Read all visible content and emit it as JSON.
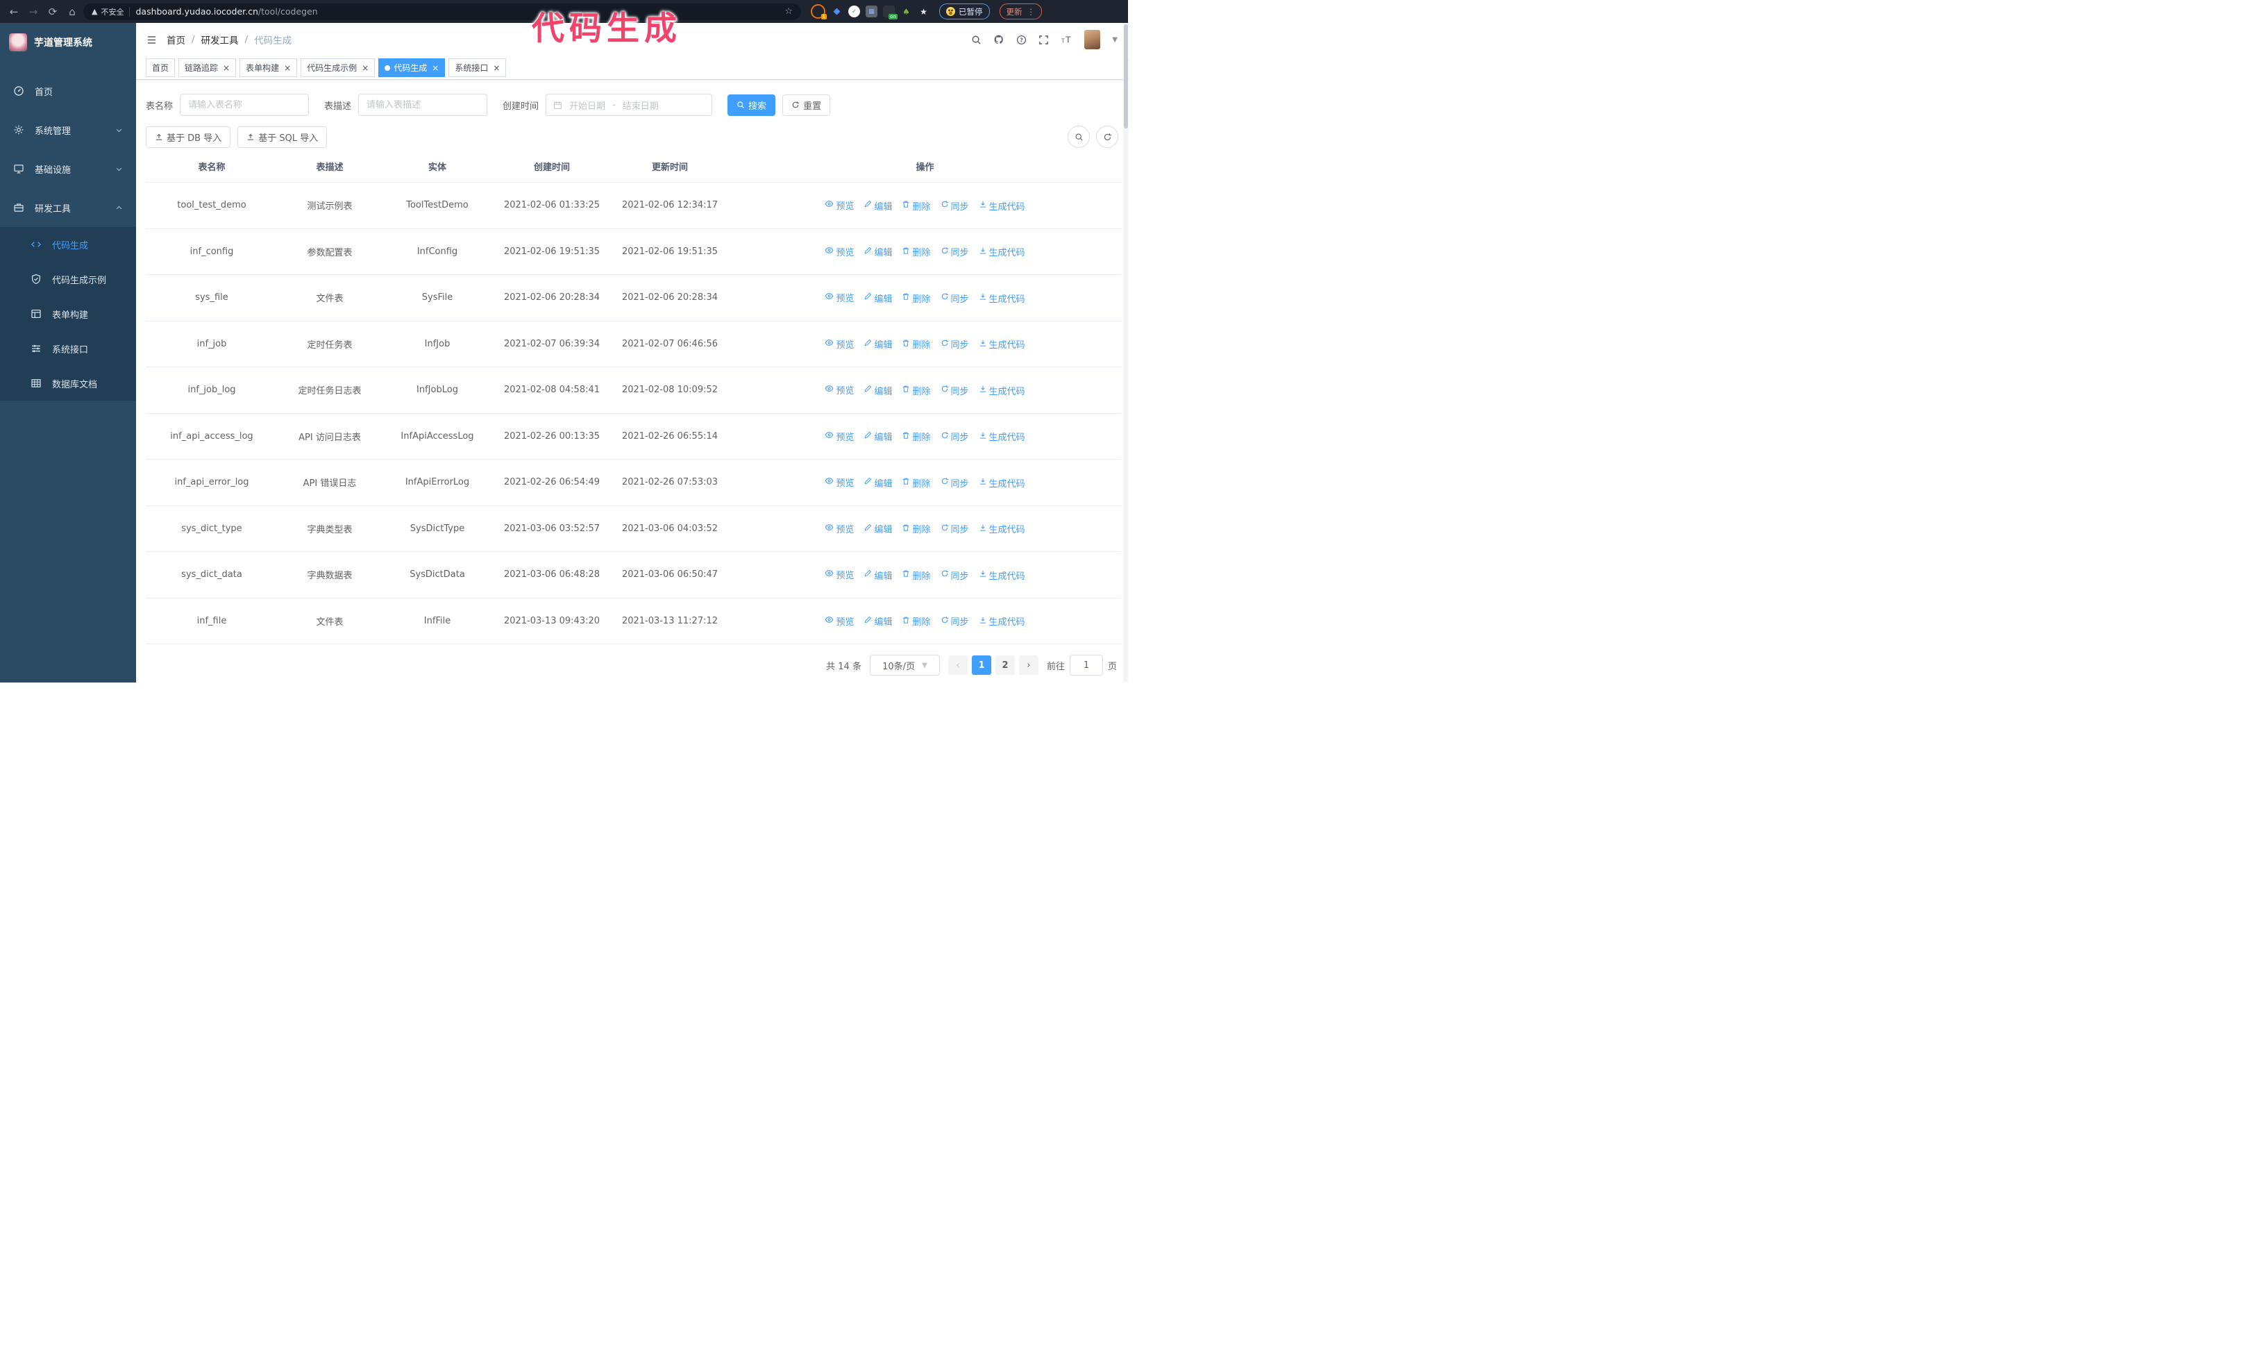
{
  "annotation": {
    "text": "代码生成",
    "color": "#f2436a"
  },
  "browser": {
    "security_label": "不安全",
    "url_host": "dashboard.yudao.iocoder.cn",
    "url_path": "/tool/codegen",
    "paused_label": "已暂停",
    "update_label": "更新"
  },
  "sidebar": {
    "logo_title": "芋道管理系统",
    "menu": [
      {
        "label": "首页",
        "icon": "home-icon"
      },
      {
        "label": "系统管理",
        "icon": "gear-icon",
        "chevron": "down"
      },
      {
        "label": "基础设施",
        "icon": "monitor-icon",
        "chevron": "down"
      },
      {
        "label": "研发工具",
        "icon": "toolbox-icon",
        "chevron": "up",
        "children": [
          {
            "label": "代码生成",
            "icon": "code-icon",
            "active": true
          },
          {
            "label": "代码生成示例",
            "icon": "shield-check-icon"
          },
          {
            "label": "表单构建",
            "icon": "form-icon"
          },
          {
            "label": "系统接口",
            "icon": "sliders-icon"
          },
          {
            "label": "数据库文档",
            "icon": "database-table-icon"
          }
        ]
      }
    ]
  },
  "header": {
    "breadcrumb": [
      "首页",
      "研发工具",
      "代码生成"
    ]
  },
  "tabs": [
    {
      "label": "首页",
      "closable": false,
      "active": false
    },
    {
      "label": "链路追踪",
      "closable": true,
      "active": false
    },
    {
      "label": "表单构建",
      "closable": true,
      "active": false
    },
    {
      "label": "代码生成示例",
      "closable": true,
      "active": false
    },
    {
      "label": "代码生成",
      "closable": true,
      "active": true
    },
    {
      "label": "系统接口",
      "closable": true,
      "active": false
    }
  ],
  "filters": {
    "table_name_label": "表名称",
    "table_name_placeholder": "请输入表名称",
    "table_desc_label": "表描述",
    "table_desc_placeholder": "请输入表描述",
    "create_time_label": "创建时间",
    "start_placeholder": "开始日期",
    "range_separator": "-",
    "end_placeholder": "结束日期",
    "search_label": "搜索",
    "reset_label": "重置"
  },
  "toolbar": {
    "import_db": "基于 DB 导入",
    "import_sql": "基于 SQL 导入"
  },
  "table": {
    "columns": [
      "表名称",
      "表描述",
      "实体",
      "创建时间",
      "更新时间",
      "操作"
    ],
    "actions": [
      "预览",
      "编辑",
      "删除",
      "同步",
      "生成代码"
    ],
    "rows": [
      {
        "name": "tool_test_demo",
        "desc": "测试示例表",
        "entity": "ToolTestDemo",
        "created": "2021-02-06 01:33:25",
        "updated": "2021-02-06 12:34:17"
      },
      {
        "name": "inf_config",
        "desc": "参数配置表",
        "entity": "InfConfig",
        "created": "2021-02-06 19:51:35",
        "updated": "2021-02-06 19:51:35"
      },
      {
        "name": "sys_file",
        "desc": "文件表",
        "entity": "SysFile",
        "created": "2021-02-06 20:28:34",
        "updated": "2021-02-06 20:28:34"
      },
      {
        "name": "inf_job",
        "desc": "定时任务表",
        "entity": "InfJob",
        "created": "2021-02-07 06:39:34",
        "updated": "2021-02-07 06:46:56"
      },
      {
        "name": "inf_job_log",
        "desc": "定时任务日志表",
        "entity": "InfJobLog",
        "created": "2021-02-08 04:58:41",
        "updated": "2021-02-08 10:09:52"
      },
      {
        "name": "inf_api_access_log",
        "desc": "API 访问日志表",
        "entity": "InfApiAccessLog",
        "created": "2021-02-26 00:13:35",
        "updated": "2021-02-26 06:55:14"
      },
      {
        "name": "inf_api_error_log",
        "desc": "API 错误日志",
        "entity": "InfApiErrorLog",
        "created": "2021-02-26 06:54:49",
        "updated": "2021-02-26 07:53:03"
      },
      {
        "name": "sys_dict_type",
        "desc": "字典类型表",
        "entity": "SysDictType",
        "created": "2021-03-06 03:52:57",
        "updated": "2021-03-06 04:03:52"
      },
      {
        "name": "sys_dict_data",
        "desc": "字典数据表",
        "entity": "SysDictData",
        "created": "2021-03-06 06:48:28",
        "updated": "2021-03-06 06:50:47"
      },
      {
        "name": "inf_file",
        "desc": "文件表",
        "entity": "InfFile",
        "created": "2021-03-13 09:43:20",
        "updated": "2021-03-13 11:27:12"
      }
    ]
  },
  "pagination": {
    "total_label": "共 14 条",
    "page_size": "10条/页",
    "pages": [
      "1",
      "2"
    ],
    "active_page": "1",
    "goto_label": "前往",
    "goto_value": "1",
    "goto_suffix": "页"
  }
}
